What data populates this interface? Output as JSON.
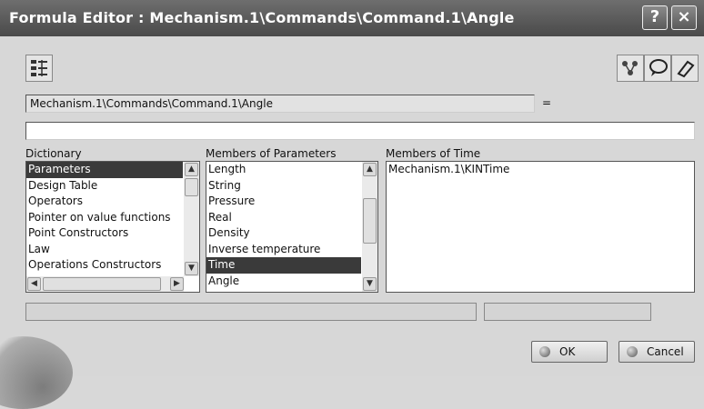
{
  "window": {
    "title": "Formula Editor : Mechanism.1\\Commands\\Command.1\\Angle",
    "help_label": "?",
    "close_label": "×"
  },
  "toolbar": {
    "left_icon": "import-parameters-icon",
    "right_icons": [
      "measure-tree-icon",
      "speech-bubble-icon",
      "eraser-icon"
    ]
  },
  "parameter_path": "Mechanism.1\\Commands\\Command.1\\Angle",
  "equals_sign": "=",
  "formula_value": "",
  "dictionary": {
    "label": "Dictionary",
    "items": [
      "Parameters",
      "Design Table",
      "Operators",
      "Pointer on value functions",
      "Point Constructors",
      "Law",
      "Operations Constructors"
    ],
    "selected": "Parameters"
  },
  "members_of_parameters": {
    "label": "Members of Parameters",
    "items": [
      "Length",
      "String",
      "Pressure",
      "Real",
      "Density",
      "Inverse temperature",
      "Time",
      "Angle"
    ],
    "selected": "Time"
  },
  "members_of_time": {
    "label": "Members of Time",
    "items": [
      "Mechanism.1\\KINTime"
    ]
  },
  "buttons": {
    "ok": "OK",
    "cancel": "Cancel"
  }
}
